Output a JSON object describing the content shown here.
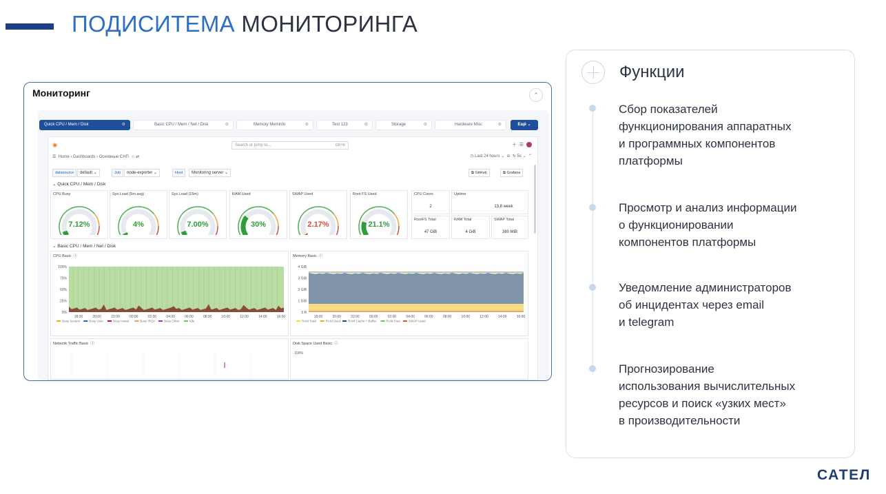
{
  "header": {
    "title_highlight": "ПОДИСИТЕМА",
    "title_rest": "МОНИТОРИНГА"
  },
  "card": {
    "title": "Мониторинг",
    "collapse_icon": "chevron-up-icon",
    "tabs": [
      {
        "label": "Quick CPU / Mem / Disk",
        "active": true
      },
      {
        "label": "Basic CPU / Mem / Net / Disk",
        "active": false
      },
      {
        "label": "Memory Meminfo",
        "active": false
      },
      {
        "label": "Test 123",
        "active": false
      },
      {
        "label": "Storage",
        "active": false
      },
      {
        "label": "Hardware Misc",
        "active": false
      }
    ],
    "tab_button": "Ещё",
    "grafana": {
      "search_placeholder": "Search or jump to...",
      "search_kbd": "ctrl+k",
      "breadcrumb": "Home › Dashboards › Основные СНП",
      "time_range": "Last 24 hours",
      "refresh": "5s",
      "vars": [
        {
          "label": "datasource",
          "value": "default"
        },
        {
          "label": "Job",
          "value": "node-exporter"
        },
        {
          "label": "Host",
          "value": "Monitoring server"
        }
      ],
      "btn_github": "GitHub",
      "btn_grafana": "Grafana",
      "row1_title": "Quick CPU / Mem / Disk",
      "gauges": [
        {
          "title": "CPU Busy",
          "value": "7.12%",
          "color": "#2e9d3a"
        },
        {
          "title": "Sys Load (5m avg)",
          "value": "4%",
          "color": "#2e9d3a"
        },
        {
          "title": "Sys Load (15m)",
          "value": "7.00%",
          "color": "#2e9d3a"
        },
        {
          "title": "RAM Used",
          "value": "30%",
          "color": "#2e9d3a"
        },
        {
          "title": "SWAP Used",
          "value": "2.17%",
          "color": "#d44a3a"
        },
        {
          "title": "Root FS Used",
          "value": "21.1%",
          "color": "#2e9d3a"
        }
      ],
      "stats": [
        {
          "title": "CPU Cores",
          "value": "2"
        },
        {
          "title": "Uptime",
          "value": "13.8 week"
        },
        {
          "title": "RootFS Total",
          "value": "47 GiB"
        },
        {
          "title": "RAM Total",
          "value": "4 GiB"
        },
        {
          "title": "SWAP Total",
          "value": "380 MiB"
        }
      ],
      "row2_title": "Basic CPU / Mem / Net / Disk",
      "cpu_chart": {
        "title": "CPU Basic",
        "yticks": [
          "100%",
          "75%",
          "50%",
          "25%",
          "0%"
        ],
        "xticks": [
          "18:00",
          "20:00",
          "22:00",
          "00:00",
          "02:00",
          "04:00",
          "06:00",
          "08:00",
          "10:00",
          "12:00",
          "14:00",
          "16:00"
        ],
        "legend": [
          {
            "name": "Busy System",
            "color": "#e0b400"
          },
          {
            "name": "Busy User",
            "color": "#1f60c4"
          },
          {
            "name": "Busy Iowait",
            "color": "#c4162a"
          },
          {
            "name": "Busy IRQs",
            "color": "#f2995b"
          },
          {
            "name": "Busy Other",
            "color": "#8f3bb8"
          },
          {
            "name": "Idle",
            "color": "#73bf69"
          }
        ]
      },
      "mem_chart": {
        "title": "Memory Basic",
        "yticks": [
          "4 GiB",
          "3 GiB",
          "2 GiB",
          "1 GiB",
          "0 B"
        ],
        "xticks": [
          "18:00",
          "20:00",
          "22:00",
          "00:00",
          "02:00",
          "04:00",
          "06:00",
          "08:00",
          "10:00",
          "12:00",
          "14:00",
          "16:00"
        ],
        "legend": [
          {
            "name": "RAM Total",
            "color": "#fade2a"
          },
          {
            "name": "RAM Used",
            "color": "#e0b400"
          },
          {
            "name": "RAM Cache + Buffer",
            "color": "#1f4f7a"
          },
          {
            "name": "RAM Free",
            "color": "#73bf69"
          },
          {
            "name": "SWAP Used",
            "color": "#e24d42"
          }
        ]
      },
      "net_chart": {
        "title": "Network Traffic Basic"
      },
      "disk_chart": {
        "title": "Disk Space Used Basic",
        "ytick": "100%"
      }
    }
  },
  "functions": {
    "title": "Функции",
    "items": [
      {
        "line1": "Сбор показателей",
        "line2": "функционирования аппаратных",
        "line3": "и программных компонентов",
        "line4": "платформы"
      },
      {
        "line1": "Просмотр и анализ информации",
        "line2": "о функционировании",
        "line3": "компонентов платформы",
        "line4": ""
      },
      {
        "line1": "Уведомление администраторов",
        "line2": "об инцидентах через email",
        "line3": "и telegram",
        "line4": ""
      },
      {
        "line1": "Прогнозирование",
        "line2": "использования вычислительных",
        "line3": "ресурсов и поиск «узких мест»",
        "line4": "в производительности"
      }
    ]
  },
  "brand": "САТЕЛ"
}
